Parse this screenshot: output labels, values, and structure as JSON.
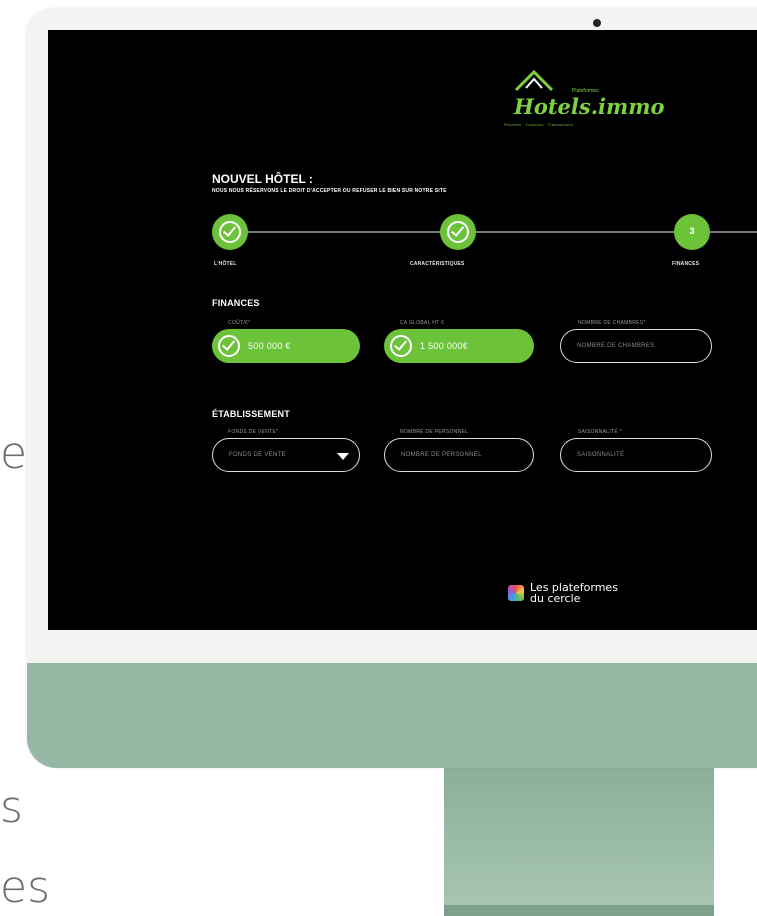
{
  "background_text": {
    "fragment1": "e",
    "fragment2": "s",
    "fragment3": "es"
  },
  "app": {
    "logo_text": "Hotels.immo",
    "logo_top": "Plateformes",
    "logo_tagline": "Reprises · Cessions · Transactions"
  },
  "page": {
    "title": "NOUVEL HÔTEL :",
    "subtitle": "NOUS NOUS RÉSERVONS LE DROIT D'ACCEPTER OU REFUSER LE BIEN SUR NOTRE SITE"
  },
  "steps": [
    {
      "label": "L'HÔTEL",
      "status": "done"
    },
    {
      "label": "CARACTÉRISTIQUES",
      "status": "done"
    },
    {
      "label": "FINANCES",
      "number": "3",
      "status": "current"
    }
  ],
  "finances": {
    "title": "FINANCES",
    "fields": [
      {
        "label": "COÛT/€*",
        "value": "500 000 €"
      },
      {
        "label": "CA GLOBAL HT €",
        "value": "1 500 000€"
      },
      {
        "label": "NOMBRE DE CHAMBRES*",
        "placeholder": "NOMBRE DE CHAMBRES"
      }
    ]
  },
  "etablissement": {
    "title": "ÉTABLISSEMENT",
    "fields": [
      {
        "label": "FONDS DE VENTE*",
        "placeholder": "FONDS DE VENTE"
      },
      {
        "label": "NOMBRE DE PERSONNEL",
        "placeholder": "NOMBRE DE PERSONNEL"
      },
      {
        "label": "SAISONNALITÉ *",
        "placeholder": "SAISONNALITÉ"
      }
    ]
  },
  "footer": {
    "brand_line1": "Les plateformes",
    "brand_line2": "du cercle"
  },
  "colors": {
    "accent": "#6cc33a",
    "screen_bg": "#000000",
    "monitor_chin": "#95b7a3"
  }
}
